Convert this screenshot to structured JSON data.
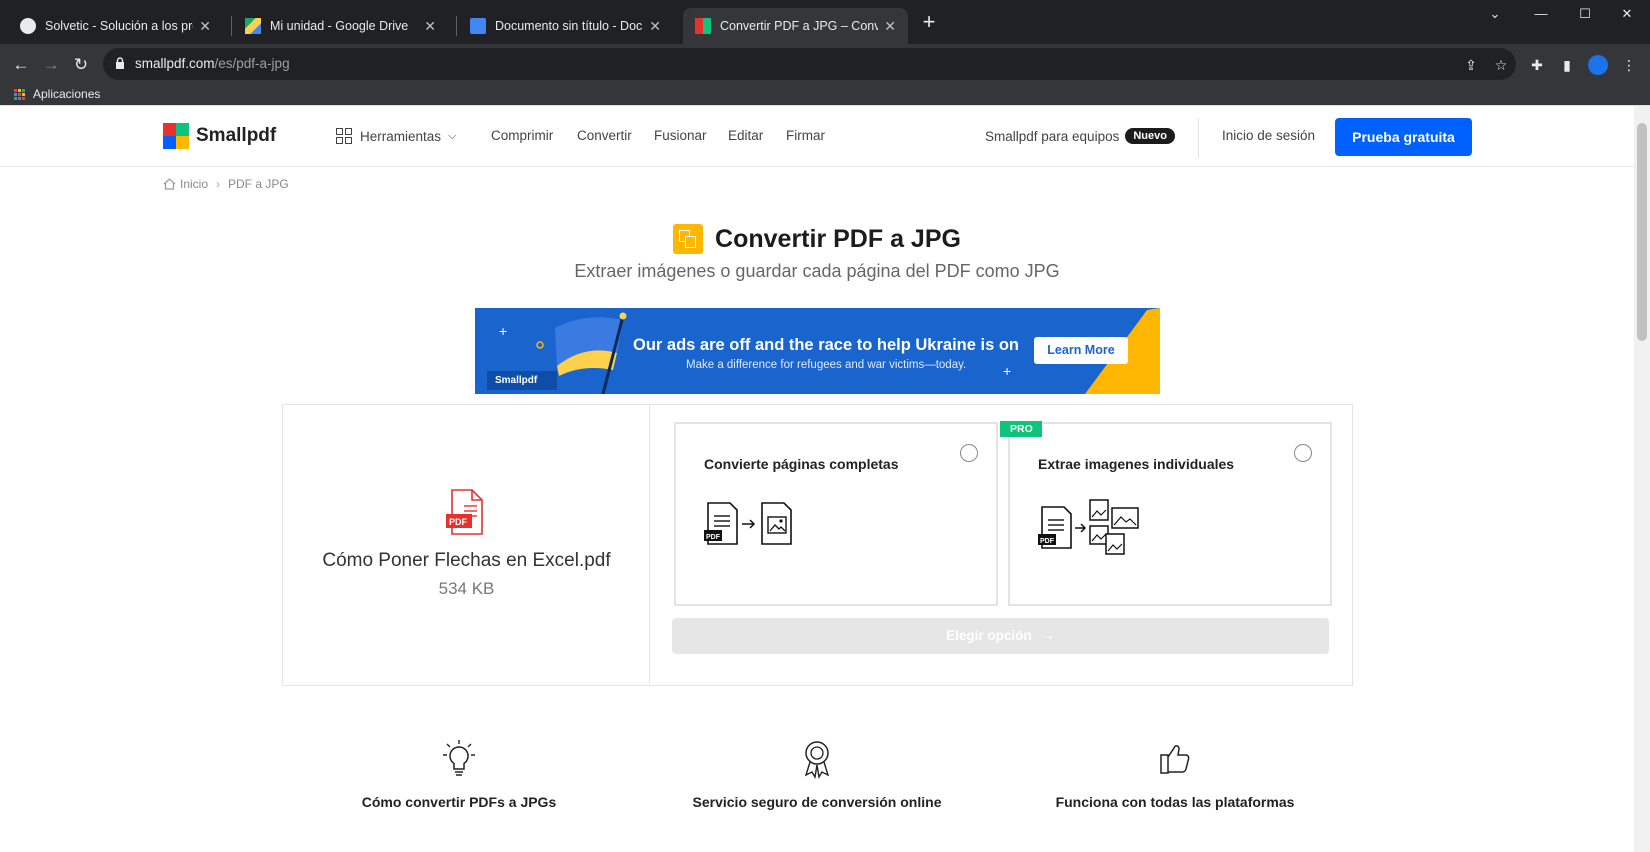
{
  "browser": {
    "tabs": [
      {
        "title": "Solvetic - Solución a los problem",
        "active": false
      },
      {
        "title": "Mi unidad - Google Drive",
        "active": false
      },
      {
        "title": "Documento sin título - Documen",
        "active": false
      },
      {
        "title": "Convertir PDF a JPG – Convierte",
        "active": true
      }
    ],
    "new_tab": "+",
    "url_host": "smallpdf.com",
    "url_path": "/es/pdf-a-jpg",
    "bookmarks": [
      {
        "label": "Aplicaciones"
      }
    ]
  },
  "site": {
    "logo_text": "Smallpdf",
    "nav": {
      "tools": "Herramientas",
      "items": [
        "Comprimir",
        "Convertir",
        "Fusionar",
        "Editar",
        "Firmar"
      ]
    },
    "teams_label": "Smallpdf para equipos",
    "new_badge": "Nuevo",
    "login": "Inicio de sesión",
    "cta": "Prueba gratuita"
  },
  "breadcrumb": {
    "home": "Inicio",
    "current": "PDF a JPG"
  },
  "main": {
    "title": "Convertir PDF a JPG",
    "subtitle": "Extraer imágenes o guardar cada página del PDF como JPG"
  },
  "ad": {
    "headline": "Our ads are off and the race to help Ukraine is on",
    "subtext": "Make a difference for refugees and war victims—today.",
    "button": "Learn More",
    "brand": "Smallpdf"
  },
  "file": {
    "name": "Cómo Poner Flechas en Excel.pdf",
    "size": "534 KB",
    "icon_label": "PDF"
  },
  "options": [
    {
      "label": "Convierte páginas completas",
      "pro": false
    },
    {
      "label": "Extrae imagenes individuales",
      "pro": true,
      "pro_label": "PRO"
    }
  ],
  "choose_button": "Elegir opción",
  "features": [
    {
      "label": "Cómo convertir PDFs a JPGs",
      "icon": "lightbulb-icon"
    },
    {
      "label": "Servicio seguro de conversión online",
      "icon": "award-ribbon-icon"
    },
    {
      "label": "Funciona con todas las plataformas",
      "icon": "thumbs-up-icon"
    }
  ],
  "colors": {
    "brand_blue": "#0061fe",
    "title_icon_yellow": "#ffb703",
    "pro_green": "#0ec37b",
    "pdf_red": "#e5322d",
    "ad_blue": "#1a64cd"
  }
}
